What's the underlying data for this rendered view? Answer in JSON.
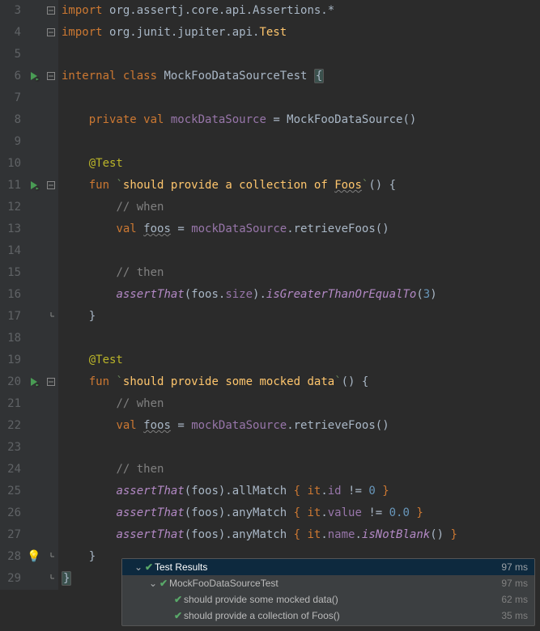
{
  "lines": [
    {
      "num": "3",
      "run": false,
      "fold": "top",
      "code": [
        [
          "kw",
          "import"
        ],
        [
          "fg",
          " "
        ],
        [
          "typ",
          "org.assertj.core.api.Assertions."
        ],
        [
          "fg",
          "*"
        ]
      ]
    },
    {
      "num": "4",
      "run": false,
      "fold": "top",
      "code": [
        [
          "kw",
          "import"
        ],
        [
          "fg",
          " "
        ],
        [
          "typ",
          "org.junit.jupiter.api."
        ],
        [
          "mdecl",
          "Test"
        ]
      ]
    },
    {
      "num": "5",
      "run": false,
      "fold": "",
      "code": []
    },
    {
      "num": "6",
      "run": true,
      "fold": "top",
      "code": [
        [
          "kw",
          "internal class"
        ],
        [
          "fg",
          " "
        ],
        [
          "typ",
          "MockFooDataSourceTest"
        ],
        [
          "fg",
          " "
        ],
        [
          "brhl",
          "{"
        ]
      ]
    },
    {
      "num": "7",
      "run": false,
      "fold": "",
      "code": []
    },
    {
      "num": "8",
      "run": false,
      "fold": "",
      "code": [
        [
          "fg",
          "    "
        ],
        [
          "kw",
          "private val"
        ],
        [
          "fg",
          " "
        ],
        [
          "prop",
          "mockDataSource"
        ],
        [
          "fg",
          " = MockFooDataSource()"
        ]
      ]
    },
    {
      "num": "9",
      "run": false,
      "fold": "",
      "code": []
    },
    {
      "num": "10",
      "run": false,
      "fold": "",
      "code": [
        [
          "fg",
          "    "
        ],
        [
          "ann",
          "@Test"
        ]
      ]
    },
    {
      "num": "11",
      "run": true,
      "fold": "top",
      "code": [
        [
          "fg",
          "    "
        ],
        [
          "kw",
          "fun"
        ],
        [
          "fg",
          " "
        ],
        [
          "str",
          "`"
        ],
        [
          "mdecl",
          "should provide a collection of "
        ],
        [
          "mdeclw",
          "Foos"
        ],
        [
          "str",
          "`"
        ],
        [
          "fg",
          "() {"
        ]
      ]
    },
    {
      "num": "12",
      "run": false,
      "fold": "",
      "code": [
        [
          "fg",
          "        "
        ],
        [
          "cmt",
          "// when"
        ]
      ]
    },
    {
      "num": "13",
      "run": false,
      "fold": "",
      "code": [
        [
          "fg",
          "        "
        ],
        [
          "kw",
          "val"
        ],
        [
          "fg",
          " "
        ],
        [
          "wavy",
          "foos"
        ],
        [
          "fg",
          " = "
        ],
        [
          "prop",
          "mockDataSource"
        ],
        [
          "fg",
          ".retrieveFoos()"
        ]
      ]
    },
    {
      "num": "14",
      "run": false,
      "fold": "",
      "code": []
    },
    {
      "num": "15",
      "run": false,
      "fold": "",
      "code": [
        [
          "fg",
          "        "
        ],
        [
          "cmt",
          "// then"
        ]
      ]
    },
    {
      "num": "16",
      "run": false,
      "fold": "",
      "code": [
        [
          "fg",
          "        "
        ],
        [
          "callit",
          "assertThat"
        ],
        [
          "fg",
          "(foos."
        ],
        [
          "prop",
          "size"
        ],
        [
          "fg",
          ")."
        ],
        [
          "callit",
          "isGreaterThanOrEqualTo"
        ],
        [
          "fg",
          "("
        ],
        [
          "num",
          "3"
        ],
        [
          "fg",
          ")"
        ]
      ]
    },
    {
      "num": "17",
      "run": false,
      "fold": "end",
      "code": [
        [
          "fg",
          "    }"
        ]
      ]
    },
    {
      "num": "18",
      "run": false,
      "fold": "",
      "code": []
    },
    {
      "num": "19",
      "run": false,
      "fold": "",
      "code": [
        [
          "fg",
          "    "
        ],
        [
          "ann",
          "@Test"
        ]
      ]
    },
    {
      "num": "20",
      "run": true,
      "fold": "top",
      "code": [
        [
          "fg",
          "    "
        ],
        [
          "kw",
          "fun"
        ],
        [
          "fg",
          " "
        ],
        [
          "str",
          "`"
        ],
        [
          "mdecl",
          "should provide some mocked data"
        ],
        [
          "str",
          "`"
        ],
        [
          "fg",
          "() {"
        ]
      ]
    },
    {
      "num": "21",
      "run": false,
      "fold": "",
      "code": [
        [
          "fg",
          "        "
        ],
        [
          "cmt",
          "// when"
        ]
      ]
    },
    {
      "num": "22",
      "run": false,
      "fold": "",
      "code": [
        [
          "fg",
          "        "
        ],
        [
          "kw",
          "val"
        ],
        [
          "fg",
          " "
        ],
        [
          "wavy",
          "foos"
        ],
        [
          "fg",
          " = "
        ],
        [
          "prop",
          "mockDataSource"
        ],
        [
          "fg",
          ".retrieveFoos()"
        ]
      ]
    },
    {
      "num": "23",
      "run": false,
      "fold": "",
      "code": []
    },
    {
      "num": "24",
      "run": false,
      "fold": "",
      "code": [
        [
          "fg",
          "        "
        ],
        [
          "cmt",
          "// then"
        ]
      ]
    },
    {
      "num": "25",
      "run": false,
      "fold": "",
      "code": [
        [
          "fg",
          "        "
        ],
        [
          "callit",
          "assertThat"
        ],
        [
          "fg",
          "(foos).allMatch "
        ],
        [
          "kw",
          "{ "
        ],
        [
          "kw",
          "it"
        ],
        [
          "fg",
          "."
        ],
        [
          "prop",
          "id"
        ],
        [
          "fg",
          " != "
        ],
        [
          "num",
          "0"
        ],
        [
          "kw",
          " }"
        ]
      ]
    },
    {
      "num": "26",
      "run": false,
      "fold": "",
      "code": [
        [
          "fg",
          "        "
        ],
        [
          "callit",
          "assertThat"
        ],
        [
          "fg",
          "(foos).anyMatch "
        ],
        [
          "kw",
          "{ "
        ],
        [
          "kw",
          "it"
        ],
        [
          "fg",
          "."
        ],
        [
          "prop",
          "value"
        ],
        [
          "fg",
          " != "
        ],
        [
          "num",
          "0.0"
        ],
        [
          "kw",
          " }"
        ]
      ]
    },
    {
      "num": "27",
      "run": false,
      "fold": "",
      "code": [
        [
          "fg",
          "        "
        ],
        [
          "callit",
          "assertThat"
        ],
        [
          "fg",
          "(foos).anyMatch "
        ],
        [
          "kw",
          "{ "
        ],
        [
          "kw",
          "it"
        ],
        [
          "fg",
          "."
        ],
        [
          "prop",
          "name"
        ],
        [
          "fg",
          "."
        ],
        [
          "callit",
          "isNotBlank"
        ],
        [
          "fg",
          "()"
        ],
        [
          "kw",
          " }"
        ]
      ]
    },
    {
      "num": "28",
      "run": false,
      "bulb": true,
      "fold": "end",
      "code": [
        [
          "fg",
          "    }"
        ]
      ]
    },
    {
      "num": "29",
      "run": false,
      "fold": "end",
      "code": [
        [
          "brhl",
          "}"
        ]
      ]
    }
  ],
  "results": {
    "header_label": "Test Results",
    "total_time": "97 ms",
    "rows": [
      {
        "indent": "ind1",
        "twist": true,
        "label": "MockFooDataSourceTest",
        "time": "97 ms"
      },
      {
        "indent": "ind2",
        "twist": false,
        "label": "should provide some mocked data()",
        "time": "62 ms"
      },
      {
        "indent": "ind2",
        "twist": false,
        "label": "should provide a collection of Foos()",
        "time": "35 ms"
      }
    ]
  }
}
